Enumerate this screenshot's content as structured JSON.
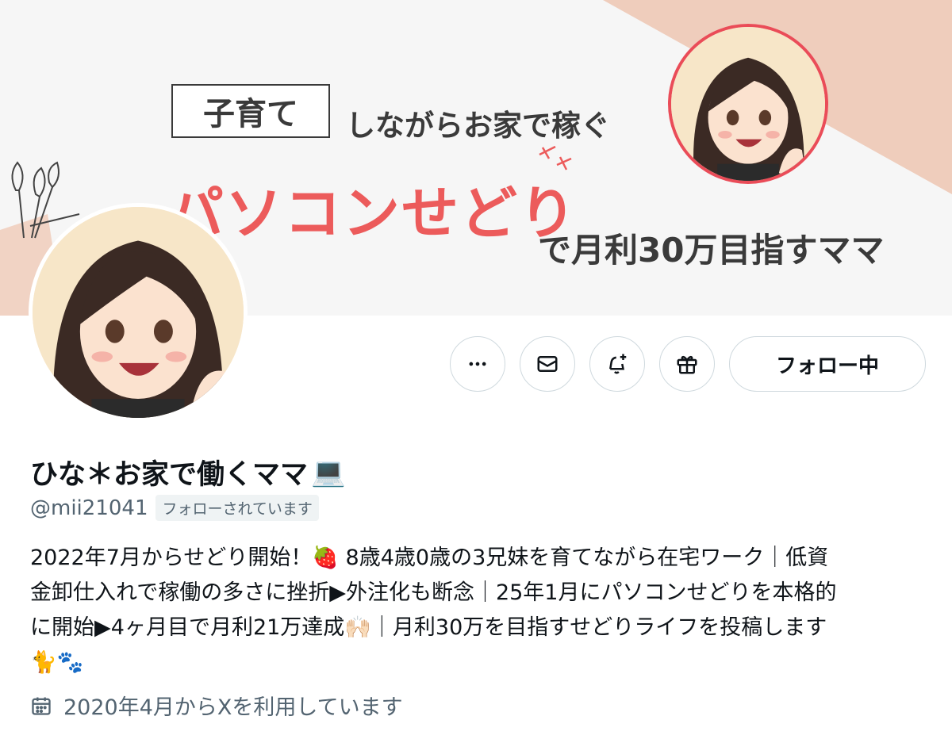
{
  "banner": {
    "tag": "子育て",
    "line1": "しながらお家で稼ぐ",
    "big_text": "パソコンせどり",
    "line3": "で月利30万目指すママ"
  },
  "actions": {
    "more_icon": "more-horizontal-icon",
    "message_icon": "envelope-icon",
    "notify_icon": "bell-plus-icon",
    "gift_icon": "gift-icon",
    "follow_label": "フォロー中"
  },
  "profile": {
    "display_name": "ひな＊お家で働くママ",
    "name_emoji": "💻",
    "handle": "@mii21041",
    "follows_you": "フォローされています",
    "bio_lines": [
      "2022年7月からせどり開始！🍓 8歳4歳0歳の3兄妹を育てながら在宅ワーク｜低資",
      "金卸仕入れで稼働の多さに挫折▶︎外注化も断念｜25年1月にパソコンせどりを本格的",
      "に開始▶︎4ヶ月目で月利21万達成🙌🏻｜月利30万を目指すせどりライフを投稿します",
      "🐈🐾"
    ],
    "joined_icon": "calendar-icon",
    "joined": "2020年4月からXを利用しています"
  },
  "colors": {
    "accent_red": "#ec5b5b",
    "banner_peach": "#efcdbc",
    "text_secondary": "#536471",
    "border": "#cfd9de"
  }
}
